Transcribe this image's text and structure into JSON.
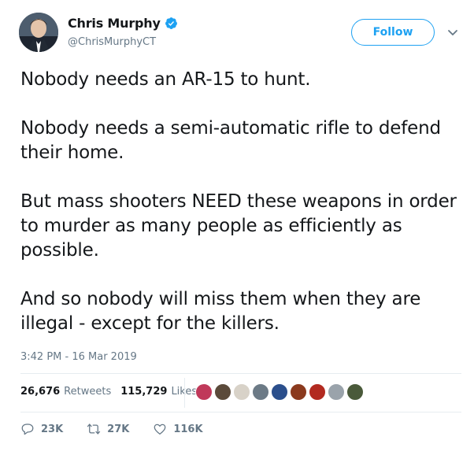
{
  "author": {
    "display_name": "Chris Murphy",
    "handle": "@ChrisMurphyCT",
    "verified": true,
    "avatar_icon": "profile-photo"
  },
  "header": {
    "follow_label": "Follow",
    "menu_icon": "chevron-down-icon"
  },
  "tweet": {
    "paragraphs": [
      "Nobody needs an AR-15 to hunt.",
      "Nobody needs a semi-automatic rifle to defend their home.",
      "But mass shooters NEED these weapons in order to murder as many people as efficiently as possible.",
      "And so nobody will miss them when they are illegal - except for the killers."
    ],
    "timestamp": "3:42 PM - 16 Mar 2019"
  },
  "stats": {
    "retweets_count": "26,676",
    "retweets_label": "Retweets",
    "likes_count": "115,729",
    "likes_label": "Likes",
    "liker_avatar_colors": [
      "#c0395a",
      "#5b4a3a",
      "#d8d2c8",
      "#6c7a86",
      "#2b4f8c",
      "#8b3a1e",
      "#b22a20",
      "#9aa3ab",
      "#4a5a3a"
    ]
  },
  "actions": {
    "reply_count": "23K",
    "retweet_count": "27K",
    "like_count": "116K"
  },
  "colors": {
    "accent": "#1da1f2",
    "muted": "#657786",
    "text": "#14171a"
  }
}
